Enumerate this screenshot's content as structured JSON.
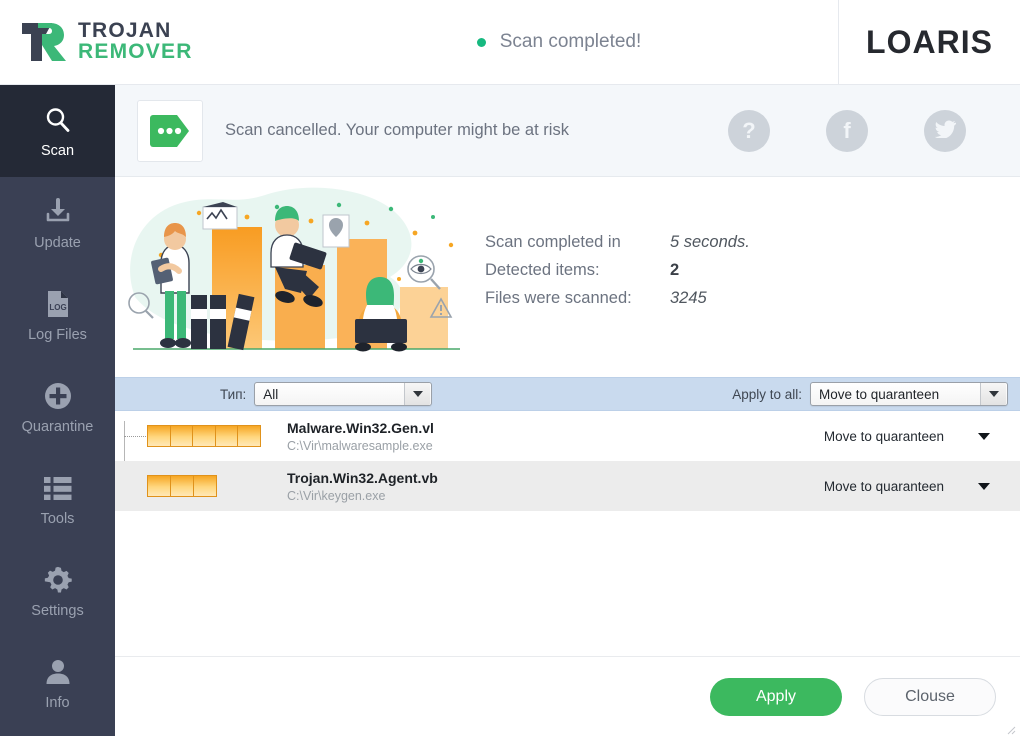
{
  "window": {
    "logo": {
      "line1": "TROJAN",
      "line2": "REMOVER",
      "icon": "trojan-remover-logo-icon"
    },
    "status": {
      "text": "Scan completed!",
      "dot_color": "#17b980"
    },
    "brand": {
      "part1": "LO",
      "accent": "A",
      "part2": "RIS"
    }
  },
  "sidebar": {
    "items": [
      {
        "label": "Scan",
        "icon": "magnifier-icon",
        "active": true
      },
      {
        "label": "Update",
        "icon": "download-icon",
        "active": false
      },
      {
        "label": "Log Files",
        "icon": "log-file-icon",
        "active": false
      },
      {
        "label": "Quarantine",
        "icon": "plus-circle-icon",
        "active": false
      },
      {
        "label": "Tools",
        "icon": "list-icon",
        "active": false
      },
      {
        "label": "Settings",
        "icon": "gear-icon",
        "active": false
      },
      {
        "label": "Info",
        "icon": "person-icon",
        "active": false
      }
    ]
  },
  "notification": {
    "badge_icon": "green-tag-dots-icon",
    "message": "Scan cancelled. Your computer might be at risk",
    "actions": [
      {
        "name": "help-button",
        "glyph": "?"
      },
      {
        "name": "facebook-button",
        "glyph": "f"
      },
      {
        "name": "twitter-button",
        "glyph": "twitter-bird-icon"
      }
    ]
  },
  "summary": {
    "rows": [
      {
        "label": "Scan completed in",
        "value": "5 seconds.",
        "style": "italic"
      },
      {
        "label": "Detected items:",
        "value": "2",
        "style": "bold"
      },
      {
        "label": "Files were scanned:",
        "value": "3245",
        "style": "italic"
      }
    ]
  },
  "filter": {
    "type_label": "Тип:",
    "type_value": "All",
    "apply_label": "Apply to all:",
    "apply_value": "Move to quaranteen"
  },
  "threats": [
    {
      "name": "Malware.Win32.Gen.vl",
      "path": "C:\\Vir\\malwaresample.exe",
      "severity_cells": 5,
      "action": "Move to quaranteen"
    },
    {
      "name": "Trojan.Win32.Agent.vb",
      "path": "C:\\Vir\\keygen.exe",
      "severity_cells": 3,
      "action": "Move to quaranteen"
    }
  ],
  "footer": {
    "apply_label": "Apply",
    "close_label": "Clouse"
  },
  "colors": {
    "green": "#3cb95f",
    "sidebar": "#3a4054",
    "sidebar_active": "#242936",
    "filter_bar": "#c9daee",
    "severity_orange": "#f6a623"
  }
}
